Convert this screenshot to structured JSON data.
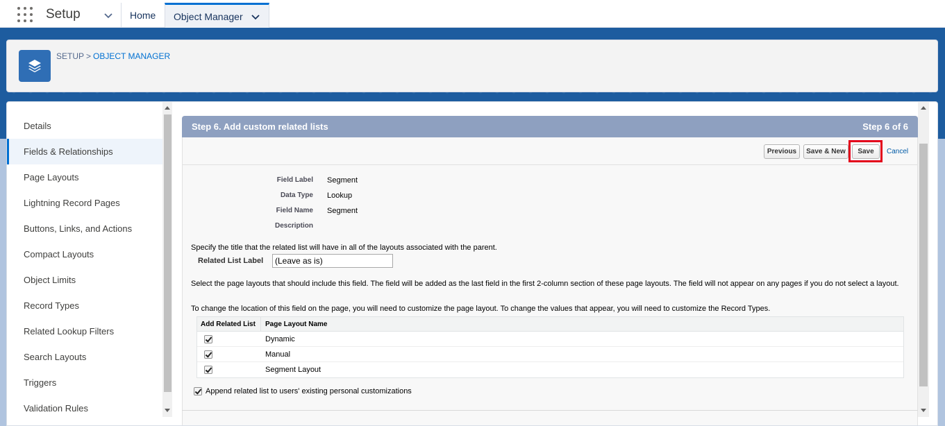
{
  "topnav": {
    "app_name": "Setup",
    "tabs": [
      {
        "label": "Home"
      },
      {
        "label": "Object Manager"
      }
    ]
  },
  "header": {
    "breadcrumb_root": "SETUP",
    "breadcrumb_sep": ">",
    "breadcrumb_current": "OBJECT MANAGER"
  },
  "sidebar": {
    "items": [
      {
        "label": "Details"
      },
      {
        "label": "Fields & Relationships",
        "active": true
      },
      {
        "label": "Page Layouts"
      },
      {
        "label": "Lightning Record Pages"
      },
      {
        "label": "Buttons, Links, and Actions"
      },
      {
        "label": "Compact Layouts"
      },
      {
        "label": "Object Limits"
      },
      {
        "label": "Record Types"
      },
      {
        "label": "Related Lookup Filters"
      },
      {
        "label": "Search Layouts"
      },
      {
        "label": "Triggers"
      },
      {
        "label": "Validation Rules"
      }
    ]
  },
  "step": {
    "title": "Step 6. Add custom related lists",
    "count": "Step 6 of 6"
  },
  "buttons": {
    "previous": "Previous",
    "save_new": "Save & New",
    "save": "Save",
    "cancel": "Cancel"
  },
  "fields": {
    "field_label_label": "Field Label",
    "field_label_value": "Segment",
    "data_type_label": "Data Type",
    "data_type_value": "Lookup",
    "field_name_label": "Field Name",
    "field_name_value": "Segment",
    "description_label": "Description"
  },
  "related_list": {
    "instruction": "Specify the title that the related list will have in all of the layouts associated with the parent.",
    "label": "Related List Label",
    "value": "(Leave as is)"
  },
  "layout_instructions": {
    "p1": "Select the page layouts that should include this field. The field will be added as the last field in the first 2-column section of these page layouts. The field will not appear on any pages if you do not select a layout.",
    "p2": "To change the location of this field on the page, you will need to customize the page layout. To change the values that appear, you will need to customize the Record Types."
  },
  "layout_table": {
    "col1": "Add Related List",
    "col2": "Page Layout Name",
    "rows": [
      {
        "name": "Dynamic",
        "checked": true
      },
      {
        "name": "Manual",
        "checked": true
      },
      {
        "name": "Segment Layout",
        "checked": true
      }
    ]
  },
  "append": {
    "label": "Append related list to users' existing personal customizations",
    "checked": true
  },
  "colors": {
    "brand_blue": "#1d5c9f",
    "step_header": "#8ea0c0",
    "highlight_red": "#e3001b",
    "link_blue": "#0070d2"
  }
}
